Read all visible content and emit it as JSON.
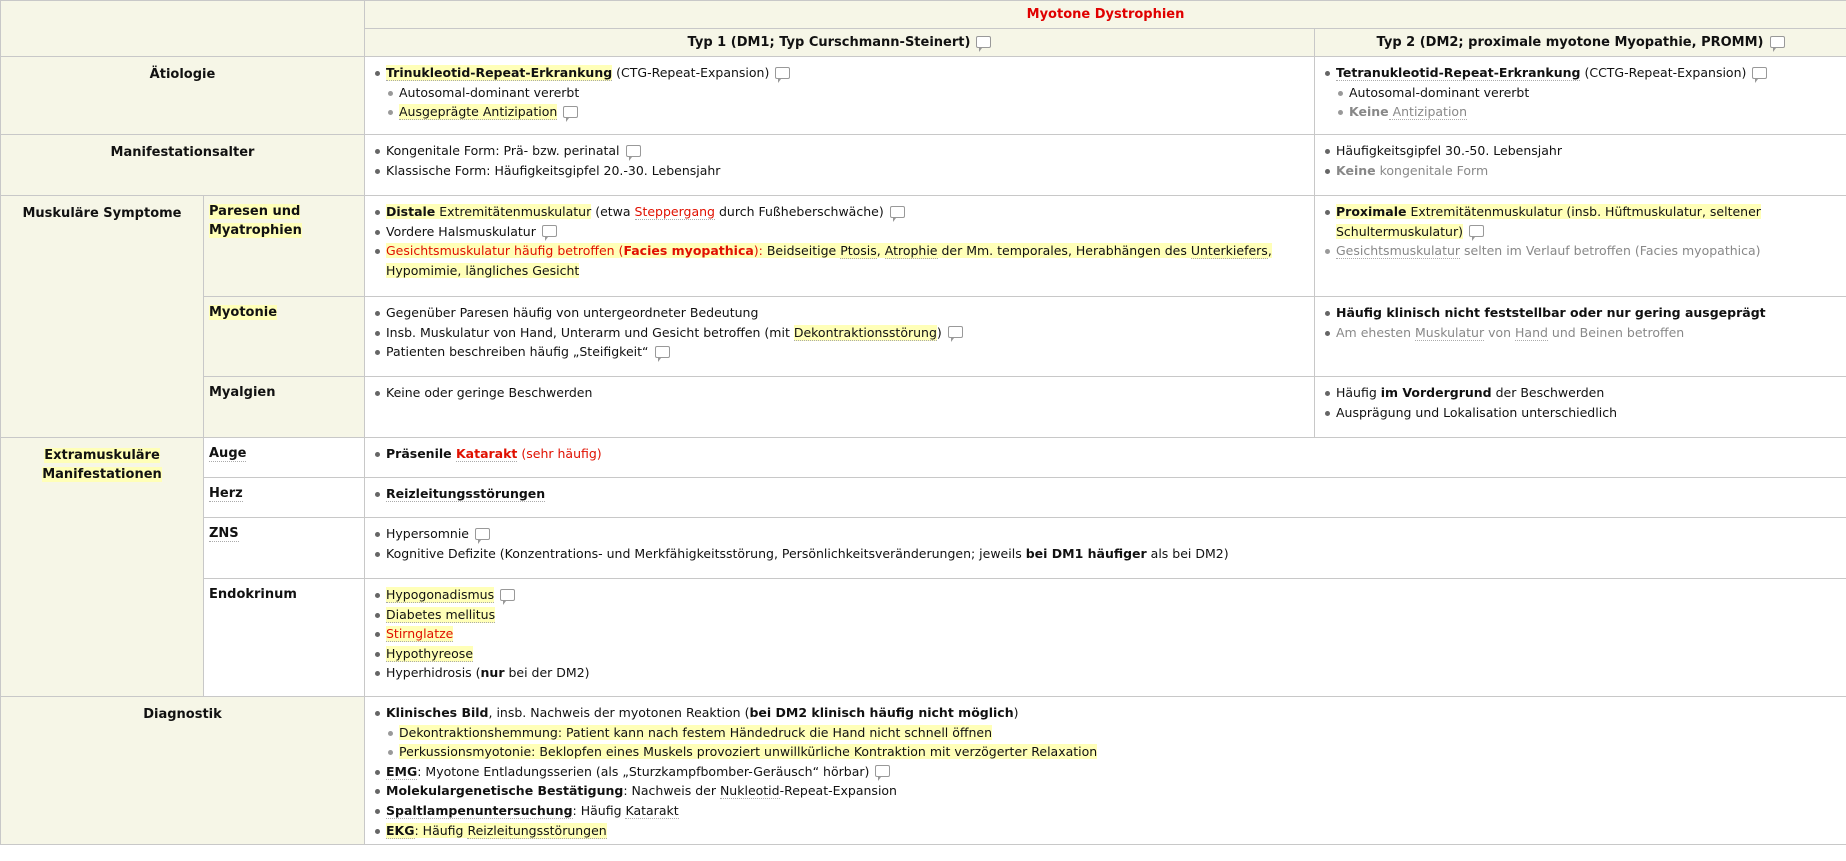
{
  "header": {
    "title": "Myotone Dystrophien",
    "typ1": "Typ 1 (DM1; Typ Curschmann-Steinert)",
    "typ2": "Typ 2 (DM2; proximale myotone Myopathie, PROMM)"
  },
  "rows": {
    "aetiologie": "Ätiologie",
    "manifestationsalter": "Manifestationsalter",
    "muskulaer": "Muskuläre Symptome",
    "paresen": "Paresen und Myatrophien",
    "myotonie": "Myotonie",
    "myalgien": "Myalgien",
    "extramuskulaer": "Extramuskuläre Manifestationen",
    "auge": "Auge",
    "herz": "Herz",
    "zns": "ZNS",
    "endokrinum": "Endokrinum",
    "diagnostik": "Diagnostik"
  },
  "aetiologie": {
    "t1": {
      "a1": "Trinukleotid-Repeat-Erkrankung",
      "a2": " (CTG-Repeat-Expansion)",
      "b": "Autosomal-dominant vererbt",
      "c": "Ausgeprägte Antizipation"
    },
    "t2": {
      "a1": "Tetranukleotid-Repeat-Erkrankung",
      "a2": " (CCTG-Repeat-Expansion)",
      "b": "Autosomal-dominant vererbt",
      "c1": "Keine",
      "c2": " Antizipation"
    }
  },
  "manifest": {
    "t1": {
      "a": "Kongenitale Form: Prä- bzw. perinatal",
      "b": "Klassische Form: Häufigkeitsgipfel 20.-30. Lebensjahr"
    },
    "t2": {
      "a": "Häufigkeitsgipfel 30.-50. Lebensjahr",
      "b1": "Keine",
      "b2": " kongenitale Form"
    }
  },
  "paresen": {
    "t1": {
      "a1": "Distale",
      "a2": " Extremitätenmuskulatur",
      "a3": " (etwa ",
      "a4": "Steppergang",
      "a5": " durch Fußheberschwäche)",
      "b": "Vordere Halsmuskulatur",
      "c1": "Gesichtsmuskulatur häufig betroffen (",
      "c2": "Facies myopathica",
      "c3": "): ",
      "c4": "Beidseitige ",
      "c5": "Ptosis",
      "c6": ", ",
      "c7": "Atrophie",
      "c8": " der Mm. temporales, Herabhängen des ",
      "c9": "Unterkiefers",
      "c10": ",",
      "c11": "Hypomimie, längliches Gesicht"
    },
    "t2": {
      "a1": "Proximale",
      "a2": " Extremitätenmuskulatur (insb. Hüftmuskulatur, seltener",
      "a3": "Schultermuskulatur)",
      "b1": "Gesichtsmuskulatur",
      "b2": " selten im Verlauf betroffen (Facies myopathica)"
    }
  },
  "myotonie": {
    "t1": {
      "a": "Gegenüber Paresen häufig von untergeordneter Bedeutung",
      "b1": "Insb. Muskulatur von Hand, Unterarm und Gesicht betroffen (mit ",
      "b2": "Dekontraktionsstörung",
      "b3": ")",
      "c": "Patienten beschreiben häufig „Steifigkeit“"
    },
    "t2": {
      "a": "Häufig klinisch nicht feststellbar oder nur gering ausgeprägt",
      "b1": "Am ehesten ",
      "b2": "Muskulatur",
      "b3": " von ",
      "b4": "Hand",
      "b5": " und Beinen betroffen"
    }
  },
  "myalgien": {
    "t1": {
      "a": "Keine oder geringe Beschwerden"
    },
    "t2": {
      "a1": "Häufig ",
      "a2": "im Vordergrund",
      "a3": " der Beschwerden",
      "b": "Ausprägung und Lokalisation unterschiedlich"
    }
  },
  "auge": {
    "a1": "Präsenile ",
    "a2": "Katarakt",
    "a3": " (sehr häufig)"
  },
  "herz": {
    "a": "Reizleitungsstörungen"
  },
  "zns": {
    "a": "Hypersomnie",
    "b1": "Kognitive Defizite (Konzentrations- und Merkfähigkeitsstörung, Persönlichkeitsveränderungen; jeweils ",
    "b2": "bei DM1 häufiger",
    "b3": " als bei DM2)"
  },
  "endokrinum": {
    "a": "Hypogonadismus",
    "b": "Diabetes mellitus",
    "c": "Stirnglatze",
    "d": "Hypothyreose",
    "e1": "Hyperhidrosis (",
    "e2": "nur",
    "e3": " bei der DM2)"
  },
  "diagnostik": {
    "a1": "Klinisches Bild",
    "a2": ", insb. Nachweis der myotonen Reaktion (",
    "a3": "bei DM2 klinisch häufig nicht möglich",
    "a4": ")",
    "b": "Dekontraktionshemmung: Patient kann nach festem Händedruck die Hand nicht schnell öffnen",
    "c": "Perkussionsmyotonie: Beklopfen eines Muskels provoziert unwillkürliche Kontraktion mit verzögerter Relaxation",
    "d1": "EMG",
    "d2": ": Myotone Entladungsserien (als „Sturzkampfbomber-Geräusch“ hörbar)",
    "e1": "Molekulargenetische Bestätigung",
    "e2": ": Nachweis der ",
    "e3": "Nukleotid",
    "e4": "-Repeat-Expansion",
    "f1": "Spaltlampenuntersuchung",
    "f2": ": Häufig ",
    "f3": "Katarakt",
    "g1": "EKG",
    "g2": ": Häufig ",
    "g3": "Reizleitungsstörungen"
  },
  "icons": {
    "comment": "comment-icon"
  },
  "colors": {
    "accent_red": "#e01000",
    "highlight": "#ffffb8",
    "label_bg": "#f6f6e7"
  }
}
